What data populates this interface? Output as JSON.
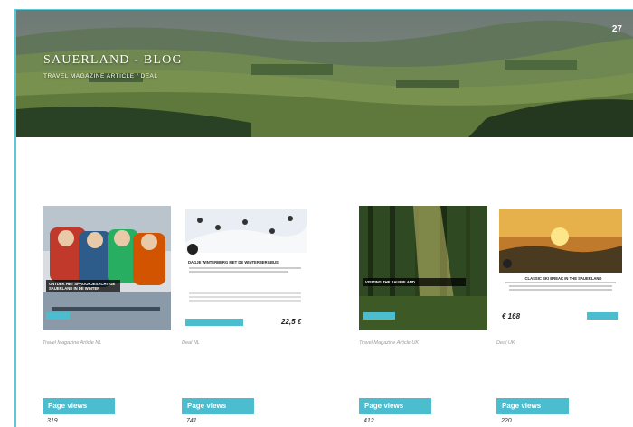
{
  "header": {
    "title": "SAUERLAND - BLOG",
    "subtitle": "TRAVEL MAGAZINE ARTICLE / DEAL",
    "page_number": "27"
  },
  "items": [
    {
      "caption": "Travel Magazine Article NL",
      "thumb_title": "ONTDEK HET SPROOKJESACHTIGE SAUERLAND IN DE WINTER",
      "views_label": "Page views",
      "views": "319"
    },
    {
      "caption": "Deal NL",
      "thumb_title": "DAGJE WINTERBERG MET DE WINTERBERGBUS",
      "price": "22,5 €",
      "views_label": "Page views",
      "views": "741"
    },
    {
      "caption": "Travel Magazine Article UK",
      "thumb_title": "VISITING THE SAUERLAND",
      "views_label": "Page views",
      "views": "412"
    },
    {
      "caption": "Deal UK",
      "thumb_title": "CLASSIC SKI BREAK IN THE SAUERLAND",
      "price": "€ 168",
      "views_label": "Page views",
      "views": "220"
    }
  ],
  "colors": {
    "accent": "#4bbdcf"
  }
}
